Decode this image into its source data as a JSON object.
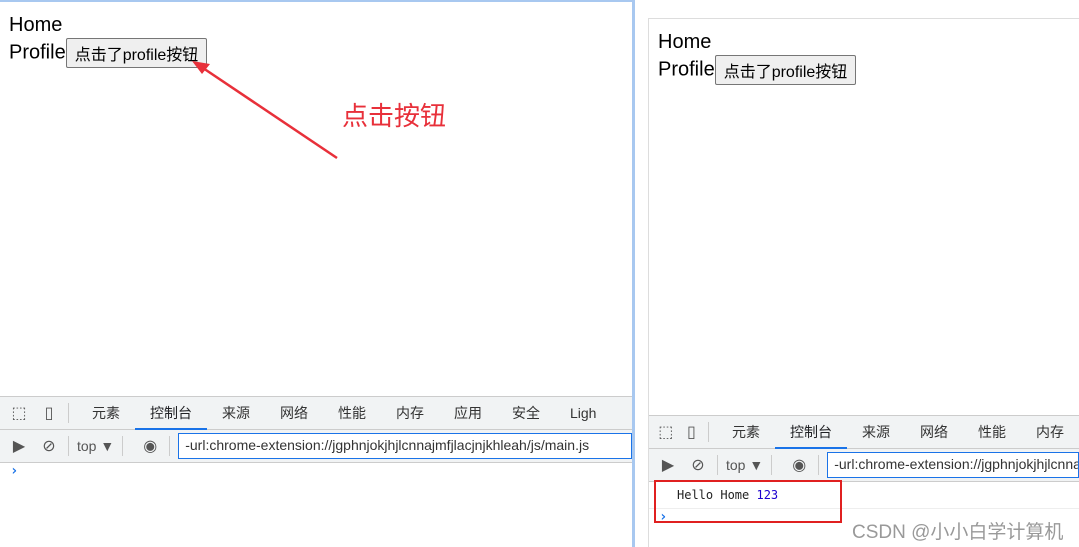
{
  "page": {
    "links": [
      "Home",
      "Profile"
    ],
    "button_label": "点击了profile按钮"
  },
  "annotation": {
    "text": "点击按钮",
    "color": "#e8303a"
  },
  "devtools": {
    "tabs": [
      "元素",
      "控制台",
      "来源",
      "网络",
      "性能",
      "内存",
      "应用",
      "安全",
      "Ligh"
    ],
    "active_tab": "控制台",
    "context": "top ▼",
    "filter_value": "-url:chrome-extension://jgphnjokjhjlcnnajmfjlacjnjkhleah/js/main.js"
  },
  "console": {
    "log_text": "Hello Home",
    "log_number": "123",
    "prompt": "›"
  },
  "watermark": "CSDN @小小白学计算机"
}
